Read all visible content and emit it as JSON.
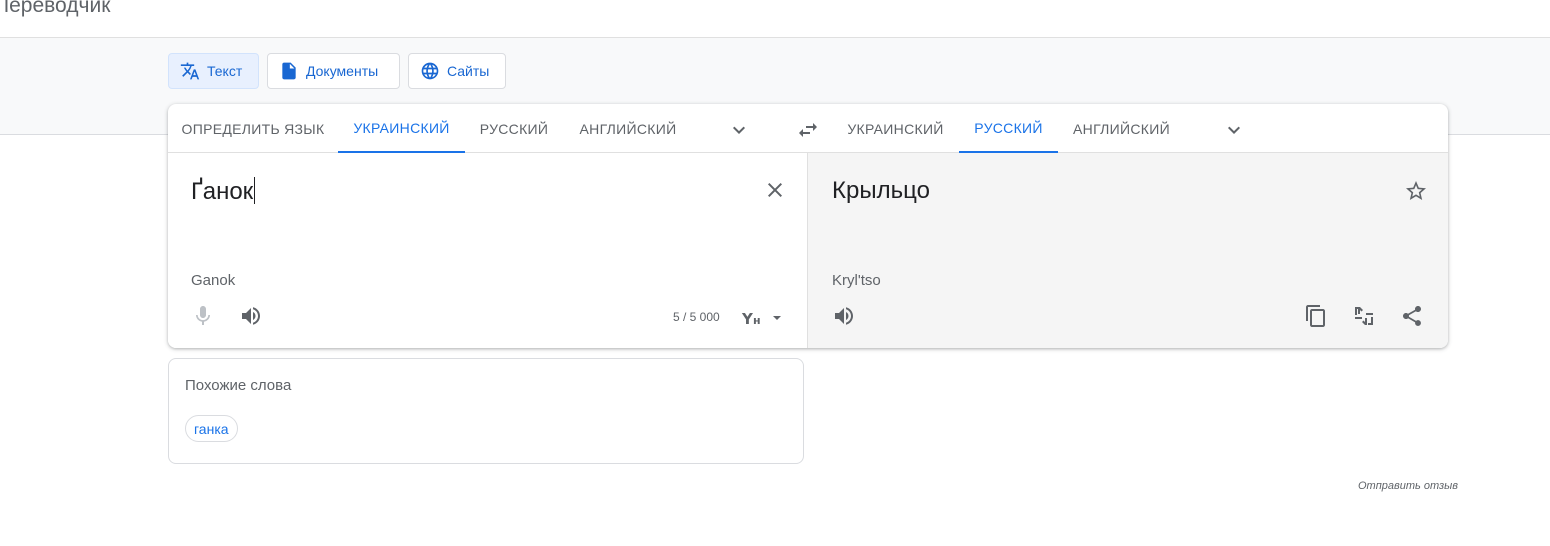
{
  "app": {
    "title": "Переводчик"
  },
  "modes": [
    {
      "label": "Текст",
      "icon": "translate-icon",
      "active": true
    },
    {
      "label": "Документы",
      "icon": "document-icon",
      "active": false
    },
    {
      "label": "Сайты",
      "icon": "globe-icon",
      "active": false
    }
  ],
  "source_langs": {
    "detect": "ОПРЕДЕЛИТЬ ЯЗЫК",
    "items": [
      "УКРАИНСКИЙ",
      "РУССКИЙ",
      "АНГЛИЙСКИЙ"
    ],
    "selected": "УКРАИНСКИЙ"
  },
  "target_langs": {
    "items": [
      "УКРАИНСКИЙ",
      "РУССКИЙ",
      "АНГЛИЙСКИЙ"
    ],
    "selected": "РУССКИЙ"
  },
  "source": {
    "text": "Ґанок",
    "transliteration": "Ganok",
    "char_count": "5 / 5 000"
  },
  "target": {
    "text": "Крыльцо",
    "transliteration": "Kryl'tso"
  },
  "similar": {
    "title": "Похожие слова",
    "words": [
      "ганка"
    ]
  },
  "feedback": "Отправить отзыв",
  "colors": {
    "accent": "#1a73e8",
    "target_bg": "#f5f5f5"
  }
}
